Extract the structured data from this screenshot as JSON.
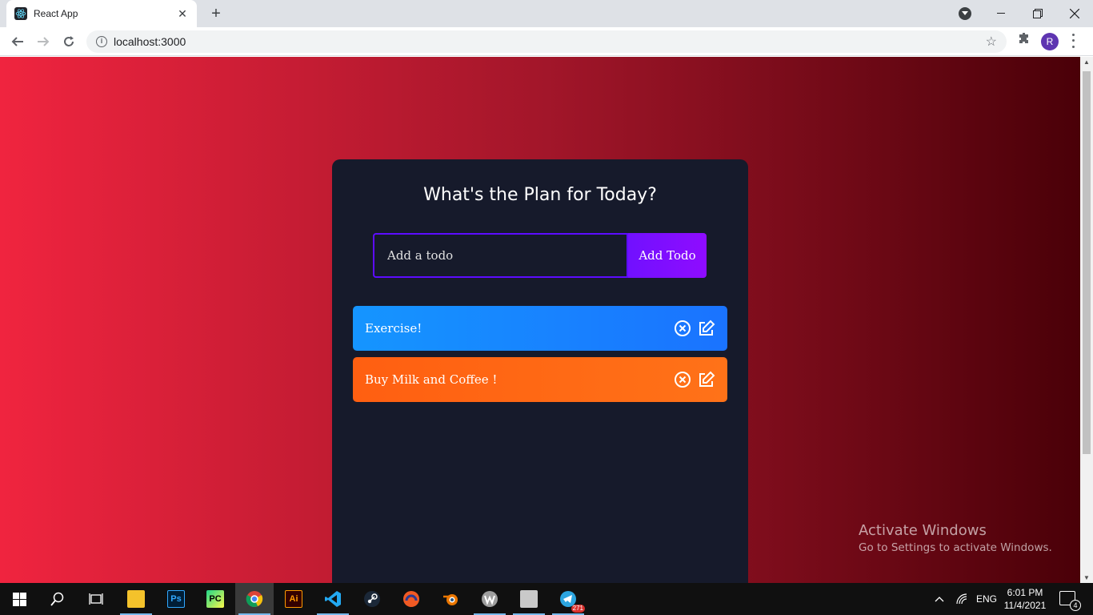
{
  "browser": {
    "tab_title": "React App",
    "url": "localhost:3000",
    "profile_initial": "R"
  },
  "app": {
    "heading": "What's the Plan for Today?",
    "input_placeholder": "Add a todo",
    "add_button_label": "Add Todo",
    "todos": [
      {
        "text": "Exercise!",
        "color": "#1595ff"
      },
      {
        "text": "Buy Milk and Coffee !",
        "color": "#ff5f11"
      }
    ]
  },
  "watermark": {
    "title": "Activate Windows",
    "subtitle": "Go to Settings to activate Windows."
  },
  "taskbar": {
    "apps": [
      "start",
      "search",
      "task-view",
      "file-explorer",
      "photoshop",
      "pycharm",
      "chrome",
      "illustrator",
      "vscode",
      "steam",
      "app-orange",
      "blender",
      "app-w",
      "app-gray",
      "telegram"
    ],
    "telegram_badge": "271",
    "language": "ENG",
    "time": "6:01 PM",
    "date": "11/4/2021",
    "notification_count": "4"
  },
  "colors": {
    "bg_left": "#f0243f",
    "bg_right": "#4a0008",
    "card": "#161a2b",
    "accent": "#5d0cff"
  }
}
